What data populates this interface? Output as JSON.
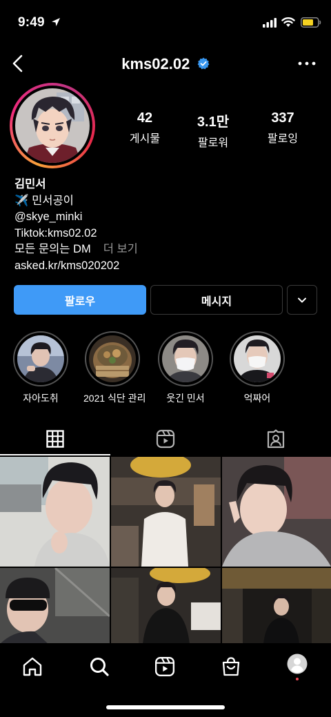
{
  "status_bar": {
    "time": "9:49"
  },
  "header": {
    "username": "kms02.02",
    "verified": true
  },
  "stats": [
    {
      "value": "42",
      "label": "게시물"
    },
    {
      "value": "3.1만",
      "label": "팔로워"
    },
    {
      "value": "337",
      "label": "팔로잉"
    }
  ],
  "bio": {
    "name": "김민서",
    "line1": "✈️ 민서공이",
    "line2": "@skye_minki",
    "line3": "Tiktok:kms02.02",
    "line4": "모든 문의는 DM",
    "more": "더 보기",
    "link": "asked.kr/kms020202"
  },
  "buttons": {
    "follow": "팔로우",
    "message": "메시지"
  },
  "highlights": [
    {
      "label": "자아도취"
    },
    {
      "label": "2021 식단 관리"
    },
    {
      "label": "웃긴 민서"
    },
    {
      "label": "억짜어"
    }
  ],
  "tabs": [
    "grid-icon",
    "reels-icon",
    "tagged-icon"
  ],
  "colors": {
    "accent": "#3f9af7",
    "verified": "#3897f0",
    "notification": "#ed4956"
  }
}
